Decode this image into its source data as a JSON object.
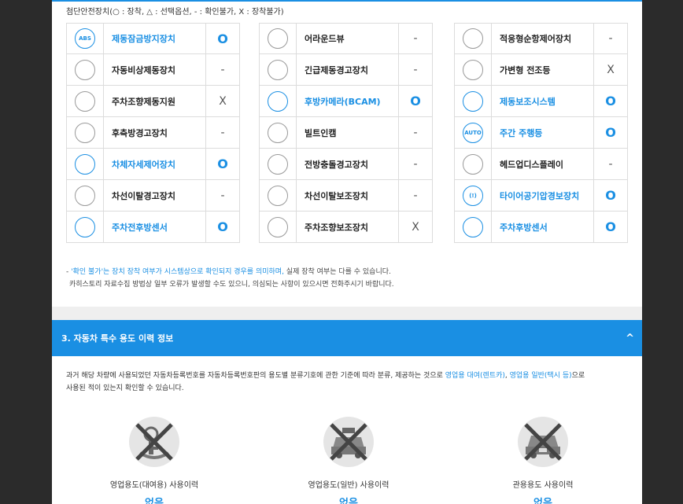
{
  "legend": "첨단안전장치(○ : 장착, △ : 선택옵션, - : 확인불가, X : 장착불가)",
  "options": {
    "col1": [
      {
        "icon": "abs-icon",
        "icon_text": "ABS",
        "name": "제동잠금방지장치",
        "value": "O",
        "highlight": true
      },
      {
        "icon": "emergency-brake-icon",
        "icon_text": "",
        "name": "자동비상제동장치",
        "value": "-",
        "highlight": false
      },
      {
        "icon": "parking-steer-icon",
        "icon_text": "",
        "name": "주차조향제동지원",
        "value": "X",
        "highlight": false
      },
      {
        "icon": "rear-warning-icon",
        "icon_text": "",
        "name": "후측방경고장치",
        "value": "-",
        "highlight": false
      },
      {
        "icon": "stability-control-icon",
        "icon_text": "",
        "name": "차체자세제어장치",
        "value": "O",
        "highlight": true
      },
      {
        "icon": "lane-departure-icon",
        "icon_text": "",
        "name": "차선이탈경고장치",
        "value": "-",
        "highlight": false
      },
      {
        "icon": "parking-sensor-icon",
        "icon_text": "",
        "name": "주차전후방센서",
        "value": "O",
        "highlight": true
      }
    ],
    "col2": [
      {
        "icon": "around-view-icon",
        "icon_text": "",
        "name": "어라운드뷰",
        "value": "-",
        "highlight": false
      },
      {
        "icon": "emergency-warning-icon",
        "icon_text": "",
        "name": "긴급제동경고장치",
        "value": "-",
        "highlight": false
      },
      {
        "icon": "rear-camera-icon",
        "icon_text": "",
        "name": "후방카메라(BCAM)",
        "value": "O",
        "highlight": true
      },
      {
        "icon": "builtin-cam-icon",
        "icon_text": "",
        "name": "빌트인캠",
        "value": "-",
        "highlight": false
      },
      {
        "icon": "forward-collision-icon",
        "icon_text": "",
        "name": "전방충돌경고장치",
        "value": "-",
        "highlight": false
      },
      {
        "icon": "lane-keep-icon",
        "icon_text": "",
        "name": "차선이탈보조장치",
        "value": "-",
        "highlight": false
      },
      {
        "icon": "parking-assist-icon",
        "icon_text": "",
        "name": "주차조향보조장치",
        "value": "X",
        "highlight": false
      }
    ],
    "col3": [
      {
        "icon": "adaptive-cruise-icon",
        "icon_text": "",
        "name": "적응형순항제어장치",
        "value": "-",
        "highlight": false
      },
      {
        "icon": "adaptive-headlight-icon",
        "icon_text": "",
        "name": "가변형 전조등",
        "value": "X",
        "highlight": false
      },
      {
        "icon": "brake-assist-icon",
        "icon_text": "",
        "name": "제동보조시스템",
        "value": "O",
        "highlight": true
      },
      {
        "icon": "daytime-light-icon",
        "icon_text": "AUTO",
        "name": "주간 주행등",
        "value": "O",
        "highlight": true
      },
      {
        "icon": "hud-icon",
        "icon_text": "",
        "name": "헤드업디스플레이",
        "value": "-",
        "highlight": false
      },
      {
        "icon": "tire-pressure-icon",
        "icon_text": "(!)",
        "name": "타이어공기압경보장치",
        "value": "O",
        "highlight": true
      },
      {
        "icon": "rear-sensor-icon",
        "icon_text": "",
        "name": "주차후방센서",
        "value": "O",
        "highlight": true
      }
    ]
  },
  "notes": {
    "prefix": "- ",
    "highlight": "'확인 불가'는 장치 장착 여부가 시스템상으로 확인되지 경우를 의미하며,",
    "rest": " 실제 장착 여부는 다를 수 있습니다.",
    "line2": "카히스토리 자료수집 방법상 일부 오류가 발생할 수도 있으니, 의심되는 사항이 있으시면 전화주시기 바랍니다."
  },
  "section": {
    "title": "3. 자동차 특수 용도 이력 정보",
    "caret": "^",
    "desc_part1": "과거 해당 차량에 사용되었던 자동차등록번호를 자동차등록번호판의 용도별 분류기호에 관한 기준에 따라 분류, 제공하는 것으로 ",
    "desc_hl1": "영업용 대여(렌트카)",
    "desc_sep": ", ",
    "desc_hl2": "영업용 일반(택시 등)",
    "desc_part2": "으로",
    "desc_line2": "사용된 적이 있는지 확인할 수 있습니다."
  },
  "usage": [
    {
      "icon": "rental-car-crossed-icon",
      "label": "영업용도(대여용) 사용이력",
      "value": "없음"
    },
    {
      "icon": "taxi-crossed-icon",
      "label": "영업용도(일반) 사용이력",
      "value": "없음"
    },
    {
      "icon": "government-car-crossed-icon",
      "label": "관용용도 사용이력",
      "value": "없음"
    }
  ]
}
